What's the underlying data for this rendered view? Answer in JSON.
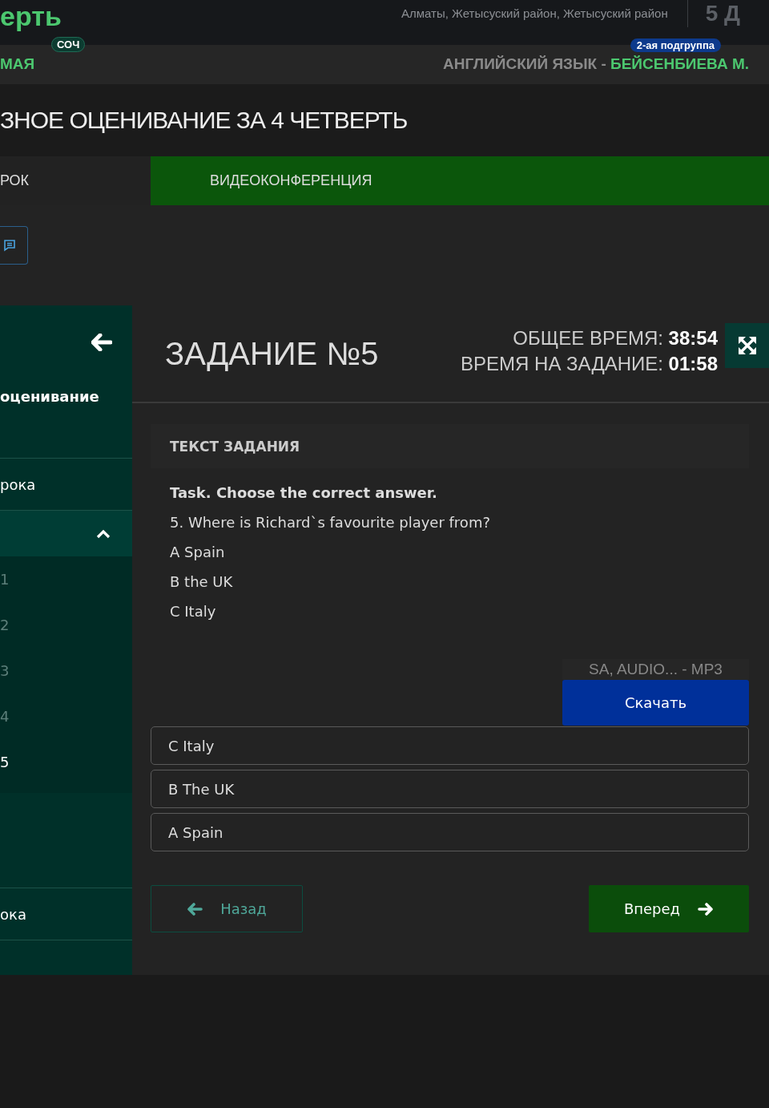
{
  "header": {
    "title_fragment": "ерть",
    "address": "Алматы, Жетысуский район, Жетысуский район",
    "class_name": "5 Д"
  },
  "subheader": {
    "badge": "СОЧ",
    "left_fragment": "МАЯ",
    "group_badge": "2-ая подгруппа",
    "subject": "АНГЛИЙСКИЙ ЯЗЫК - ",
    "teacher": "БЕЙСЕНБИЕВА М."
  },
  "page_title": "ЗНОЕ ОЦЕНИВАНИЕ ЗА 4 ЧЕТВЕРТЬ",
  "tabs": [
    {
      "label": "РОК",
      "kind": "plain"
    },
    {
      "label": "ВИДЕОКОНФЕРЕНЦИЯ",
      "kind": "green"
    }
  ],
  "sidebar": {
    "title": "оценивание",
    "items": [
      {
        "kind": "link",
        "label": "рока"
      },
      {
        "kind": "group",
        "expanded": true,
        "children": [
          {
            "label": "1",
            "selected": false
          },
          {
            "label": "2",
            "selected": false
          },
          {
            "label": "3",
            "selected": false
          },
          {
            "label": "4",
            "selected": false
          },
          {
            "label": "5",
            "selected": true
          }
        ]
      },
      {
        "kind": "link",
        "label": "ока"
      }
    ]
  },
  "task": {
    "title": "ЗАДАНИЕ №5",
    "total_time_label": "ОБЩЕЕ ВРЕМЯ: ",
    "total_time": "38:54",
    "task_time_label": "ВРЕМЯ НА ЗАДАНИЕ: ",
    "task_time": "01:58",
    "section_title": "ТЕКСТ ЗАДАНИЯ",
    "lines": [
      "**Task. Choose the correct answer.**",
      "5. Where is Richard`s favourite player from?",
      "A Spain",
      "B the UK",
      "C Italy"
    ],
    "file_name": "SA, AUDIO... - MP3",
    "download_button": "Скачать",
    "answers": [
      {
        "label": "C Italy",
        "selected": false
      },
      {
        "label": "B The UK",
        "selected": false
      },
      {
        "label": "A Spain",
        "selected": false
      }
    ],
    "back_button": "Назад",
    "next_button": "Вперед"
  }
}
